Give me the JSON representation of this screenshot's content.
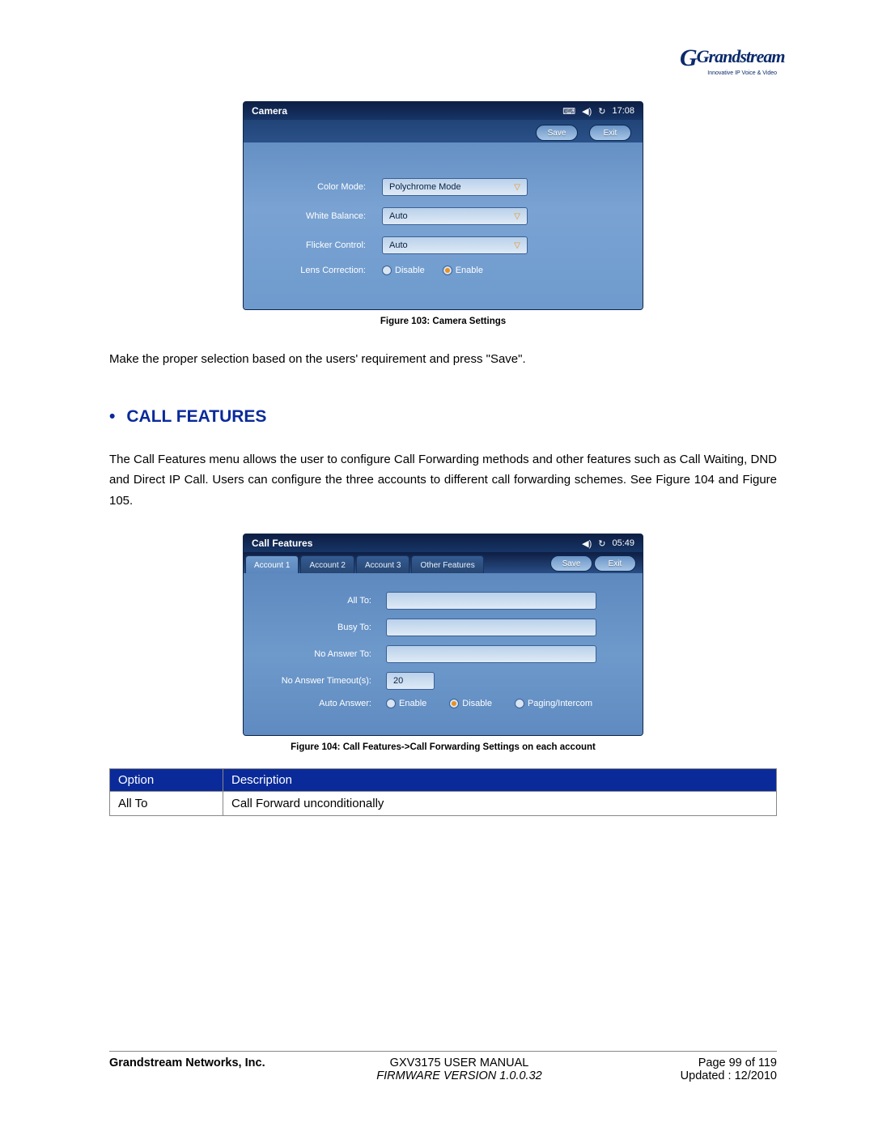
{
  "logo": {
    "brand": "Grandstream",
    "tagline": "Innovative IP Voice & Video"
  },
  "figure1": {
    "title": "Camera",
    "time": "17:08",
    "buttons": {
      "save": "Save",
      "exit": "Exit"
    },
    "rows": {
      "color_mode_label": "Color Mode:",
      "color_mode_value": "Polychrome Mode",
      "white_balance_label": "White Balance:",
      "white_balance_value": "Auto",
      "flicker_label": "Flicker Control:",
      "flicker_value": "Auto",
      "lens_label": "Lens Correction:",
      "lens_disable": "Disable",
      "lens_enable": "Enable"
    },
    "caption": "Figure 103: Camera Settings"
  },
  "paragraph1": "Make the proper selection based on the users' requirement and press \"Save\".",
  "heading": "CALL FEATURES",
  "paragraph2": "The Call Features menu allows the user to configure Call Forwarding methods and other features such as Call Waiting, DND and Direct IP Call. Users can configure the three accounts to different call forwarding schemes. See Figure 104 and Figure 105.",
  "figure2": {
    "title": "Call Features",
    "time": "05:49",
    "tabs": [
      "Account 1",
      "Account 2",
      "Account 3",
      "Other Features"
    ],
    "buttons": {
      "save": "Save",
      "exit": "Exit"
    },
    "rows": {
      "all_to": "All To:",
      "busy_to": "Busy To:",
      "no_answer_to": "No Answer To:",
      "timeout_label": "No Answer Timeout(s):",
      "timeout_value": "20",
      "auto_answer": "Auto Answer:",
      "enable": "Enable",
      "disable": "Disable",
      "paging": "Paging/Intercom"
    },
    "caption": "Figure 104: Call Features->Call Forwarding Settings on each account"
  },
  "table": {
    "headers": {
      "option": "Option",
      "description": "Description"
    },
    "row1": {
      "option": "All To",
      "description": "Call Forward unconditionally"
    }
  },
  "footer": {
    "company": "Grandstream Networks, Inc.",
    "title": "GXV3175 USER MANUAL",
    "firmware": "FIRMWARE VERSION 1.0.0.32",
    "page": "Page 99 of 119",
    "updated": "Updated : 12/2010"
  }
}
